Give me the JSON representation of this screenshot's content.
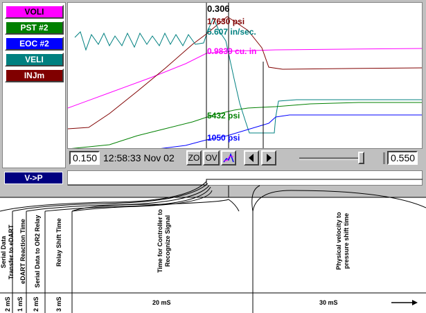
{
  "legend": [
    {
      "label": "VOLI",
      "color": "#ff00ff"
    },
    {
      "label": "PST #2",
      "color": "#008000"
    },
    {
      "label": "EOC #2",
      "color": "#0000ff"
    },
    {
      "label": "VELI",
      "color": "#008080"
    },
    {
      "label": "INJm",
      "color": "#800000"
    }
  ],
  "cursor": {
    "time_value": "0.306",
    "readouts": [
      {
        "text": "17630 psi",
        "color": "#800000"
      },
      {
        "text": "5.607 in/sec.",
        "color": "#008080"
      },
      {
        "text": "0.9839 cu. in",
        "color": "#ff00ff"
      },
      {
        "text": "5432 psi",
        "color": "#008000"
      },
      {
        "text": "1050 psi",
        "color": "#0000ff"
      }
    ]
  },
  "toolbar": {
    "start_value": "0.150",
    "timestamp": "12:58:33 Nov 02",
    "zo_label": "ZO",
    "ov_label": "OV",
    "prev_icon": "triangle-left-icon",
    "next_icon": "triangle-right-icon",
    "end_value": "0.550"
  },
  "event": {
    "label": "V->P"
  },
  "timeline": {
    "segments": [
      {
        "label_lines": [
          "Serial Data",
          "Transfer to eDART"
        ],
        "duration": "2 mS"
      },
      {
        "label_lines": [
          "eDART Reaction Time"
        ],
        "duration": "1 mS"
      },
      {
        "label_lines": [
          "Serial Data to OR2 Relay"
        ],
        "duration": "2 mS"
      },
      {
        "label_lines": [
          "Relay Shift Time"
        ],
        "duration": "3 mS"
      },
      {
        "label_lines": [
          "Time for Controller to",
          "Recognize Signal"
        ],
        "duration": "20  mS"
      },
      {
        "label_lines": [
          "Physical velocity to",
          "pressure shift time"
        ],
        "duration": "30 mS"
      }
    ]
  }
}
